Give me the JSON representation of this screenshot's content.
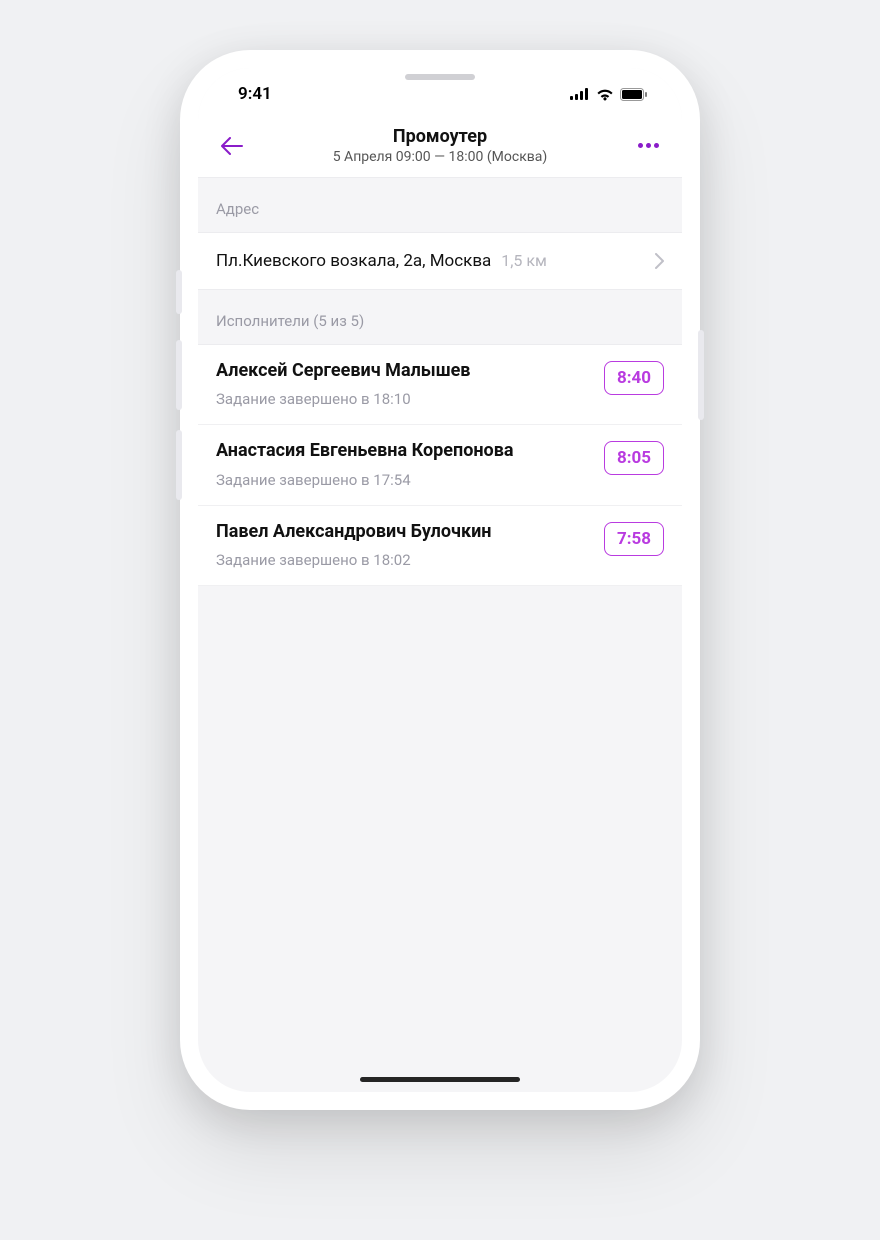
{
  "status": {
    "time": "9:41"
  },
  "nav": {
    "title": "Промоутер",
    "subtitle": "5 Апреля 09:00 — 18:00 (Москва)"
  },
  "address": {
    "section_label": "Адрес",
    "text": "Пл.Киевского возкала, 2а, Москва",
    "distance": "1,5 км"
  },
  "performers": {
    "section_label": "Исполнители (5 из 5)",
    "items": [
      {
        "name": "Алексей Сергеевич Малышев",
        "status": "Задание завершено в 18:10",
        "time": "8:40"
      },
      {
        "name": "Анастасия Евгеньевна Корепонова",
        "status": "Задание завершено в 17:54",
        "time": "8:05"
      },
      {
        "name": "Павел Александрович Булочкин",
        "status": "Задание завершено в 18:02",
        "time": "7:58"
      }
    ]
  },
  "colors": {
    "accent": "#b93be0"
  }
}
